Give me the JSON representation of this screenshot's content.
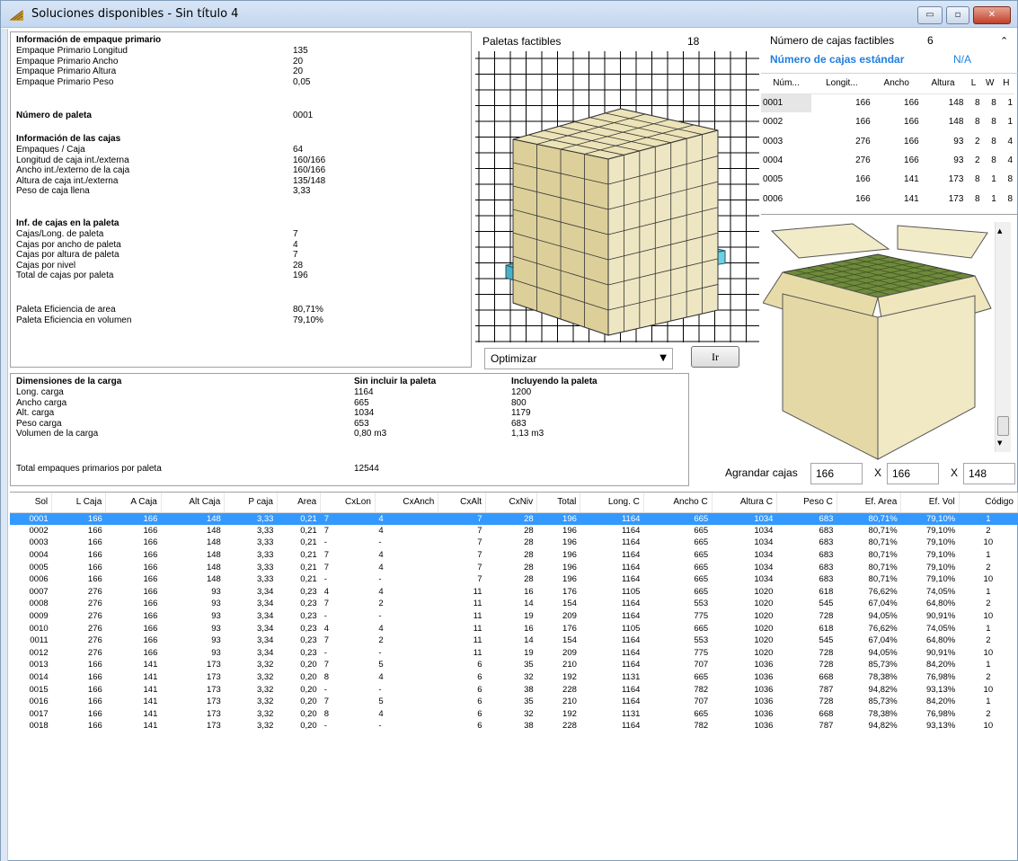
{
  "window": {
    "title": "Soluciones disponibles - Sin título 4",
    "minimize": "▭",
    "maximize": "▫",
    "close": "✕"
  },
  "primary": {
    "heading": "Información de empaque primario",
    "rows": [
      {
        "label": "Empaque Primario Longitud",
        "value": "135"
      },
      {
        "label": "Empaque Primario Ancho",
        "value": "20"
      },
      {
        "label": "Empaque Primario Altura",
        "value": "20"
      },
      {
        "label": "Empaque Primario Peso",
        "value": "0,05"
      }
    ],
    "pallet_label": "Número de paleta",
    "pallet_value": "0001",
    "cases_heading": "Información de las cajas",
    "cases_rows": [
      {
        "label": "Empaques / Caja",
        "value": "64"
      },
      {
        "label": "Longitud de caja int./externa",
        "value": "160/166"
      },
      {
        "label": "Ancho int./externo de la caja",
        "value": "160/166"
      },
      {
        "label": "Altura de caja int./externa",
        "value": "135/148"
      },
      {
        "label": "Peso de caja llena",
        "value": "3,33"
      }
    ],
    "pallet_heading": "Inf. de cajas en la paleta",
    "pallet_rows": [
      {
        "label": "Cajas/Long. de paleta",
        "value": "7"
      },
      {
        "label": "Cajas por ancho de paleta",
        "value": "4"
      },
      {
        "label": "Cajas por altura de paleta",
        "value": "7"
      },
      {
        "label": "Cajas por nivel",
        "value": "28"
      },
      {
        "label": "Total de cajas por paleta",
        "value": "196"
      }
    ],
    "eff_rows": [
      {
        "label": "Paleta Eficiencia de area",
        "value": "80,71%"
      },
      {
        "label": "Paleta Eficiencia en volumen",
        "value": "79,10%"
      }
    ]
  },
  "load": {
    "heading": "Dimensiones de la carga",
    "col1": "Sin incluir la paleta",
    "col2": "Incluyendo la paleta",
    "rows": [
      {
        "label": "Long. carga",
        "a": "1164",
        "b": "1200"
      },
      {
        "label": "Ancho carga",
        "a": "665",
        "b": "800"
      },
      {
        "label": "Alt. carga",
        "a": "1034",
        "b": "1179"
      },
      {
        "label": "Peso carga",
        "a": "653",
        "b": "683"
      },
      {
        "label": "Volumen de la carga",
        "a": "0,80 m3",
        "b": "1,13 m3"
      }
    ],
    "total_label": "Total empaques primarios por paleta",
    "total_value": "12544"
  },
  "pallet_view": {
    "label": "Paletas factibles",
    "count": "18",
    "select_value": "Optimizar",
    "go_button": "Ir"
  },
  "cases": {
    "label": "Número de cajas factibles",
    "count": "6",
    "std_label": "Número de cajas estándar",
    "std_value": "N/A",
    "headers": [
      "Núm...",
      "Longit...",
      "Ancho",
      "Altura",
      "L",
      "W",
      "H"
    ],
    "rows": [
      [
        "0001",
        "166",
        "166",
        "148",
        "8",
        "8",
        "1"
      ],
      [
        "0002",
        "166",
        "166",
        "148",
        "8",
        "8",
        "1"
      ],
      [
        "0003",
        "276",
        "166",
        "93",
        "2",
        "8",
        "4"
      ],
      [
        "0004",
        "276",
        "166",
        "93",
        "2",
        "8",
        "4"
      ],
      [
        "0005",
        "166",
        "141",
        "173",
        "8",
        "1",
        "8"
      ],
      [
        "0006",
        "166",
        "141",
        "173",
        "8",
        "1",
        "8"
      ]
    ]
  },
  "enlarge": {
    "label": "Agrandar cajas",
    "x1": "166",
    "sep1": "X",
    "x2": "166",
    "sep2": "X",
    "x3": "148"
  },
  "solutions": {
    "headers": [
      "Sol",
      "L Caja",
      "A Caja",
      "Alt Caja",
      "P caja",
      "Area",
      "CxLon",
      "CxAnch",
      "CxAlt",
      "CxNiv",
      "Total",
      "Long. C",
      "Ancho C",
      "Altura C",
      "Peso C",
      "Ef. Area",
      "Ef. Vol",
      "Código"
    ],
    "rows": [
      [
        "0001",
        "166",
        "166",
        "148",
        "3,33",
        "0,21",
        "7",
        "4",
        "7",
        "28",
        "196",
        "1164",
        "665",
        "1034",
        "683",
        "80,71%",
        "79,10%",
        "1"
      ],
      [
        "0002",
        "166",
        "166",
        "148",
        "3,33",
        "0,21",
        "7",
        "4",
        "7",
        "28",
        "196",
        "1164",
        "665",
        "1034",
        "683",
        "80,71%",
        "79,10%",
        "2"
      ],
      [
        "0003",
        "166",
        "166",
        "148",
        "3,33",
        "0,21",
        "-",
        "-",
        "7",
        "28",
        "196",
        "1164",
        "665",
        "1034",
        "683",
        "80,71%",
        "79,10%",
        "10"
      ],
      [
        "0004",
        "166",
        "166",
        "148",
        "3,33",
        "0,21",
        "7",
        "4",
        "7",
        "28",
        "196",
        "1164",
        "665",
        "1034",
        "683",
        "80,71%",
        "79,10%",
        "1"
      ],
      [
        "0005",
        "166",
        "166",
        "148",
        "3,33",
        "0,21",
        "7",
        "4",
        "7",
        "28",
        "196",
        "1164",
        "665",
        "1034",
        "683",
        "80,71%",
        "79,10%",
        "2"
      ],
      [
        "0006",
        "166",
        "166",
        "148",
        "3,33",
        "0,21",
        "-",
        "-",
        "7",
        "28",
        "196",
        "1164",
        "665",
        "1034",
        "683",
        "80,71%",
        "79,10%",
        "10"
      ],
      [
        "0007",
        "276",
        "166",
        "93",
        "3,34",
        "0,23",
        "4",
        "4",
        "11",
        "16",
        "176",
        "1105",
        "665",
        "1020",
        "618",
        "76,62%",
        "74,05%",
        "1"
      ],
      [
        "0008",
        "276",
        "166",
        "93",
        "3,34",
        "0,23",
        "7",
        "2",
        "11",
        "14",
        "154",
        "1164",
        "553",
        "1020",
        "545",
        "67,04%",
        "64,80%",
        "2"
      ],
      [
        "0009",
        "276",
        "166",
        "93",
        "3,34",
        "0,23",
        "-",
        "-",
        "11",
        "19",
        "209",
        "1164",
        "775",
        "1020",
        "728",
        "94,05%",
        "90,91%",
        "10"
      ],
      [
        "0010",
        "276",
        "166",
        "93",
        "3,34",
        "0,23",
        "4",
        "4",
        "11",
        "16",
        "176",
        "1105",
        "665",
        "1020",
        "618",
        "76,62%",
        "74,05%",
        "1"
      ],
      [
        "0011",
        "276",
        "166",
        "93",
        "3,34",
        "0,23",
        "7",
        "2",
        "11",
        "14",
        "154",
        "1164",
        "553",
        "1020",
        "545",
        "67,04%",
        "64,80%",
        "2"
      ],
      [
        "0012",
        "276",
        "166",
        "93",
        "3,34",
        "0,23",
        "-",
        "-",
        "11",
        "19",
        "209",
        "1164",
        "775",
        "1020",
        "728",
        "94,05%",
        "90,91%",
        "10"
      ],
      [
        "0013",
        "166",
        "141",
        "173",
        "3,32",
        "0,20",
        "7",
        "5",
        "6",
        "35",
        "210",
        "1164",
        "707",
        "1036",
        "728",
        "85,73%",
        "84,20%",
        "1"
      ],
      [
        "0014",
        "166",
        "141",
        "173",
        "3,32",
        "0,20",
        "8",
        "4",
        "6",
        "32",
        "192",
        "1131",
        "665",
        "1036",
        "668",
        "78,38%",
        "76,98%",
        "2"
      ],
      [
        "0015",
        "166",
        "141",
        "173",
        "3,32",
        "0,20",
        "-",
        "-",
        "6",
        "38",
        "228",
        "1164",
        "782",
        "1036",
        "787",
        "94,82%",
        "93,13%",
        "10"
      ],
      [
        "0016",
        "166",
        "141",
        "173",
        "3,32",
        "0,20",
        "7",
        "5",
        "6",
        "35",
        "210",
        "1164",
        "707",
        "1036",
        "728",
        "85,73%",
        "84,20%",
        "1"
      ],
      [
        "0017",
        "166",
        "141",
        "173",
        "3,32",
        "0,20",
        "8",
        "4",
        "6",
        "32",
        "192",
        "1131",
        "665",
        "1036",
        "668",
        "78,38%",
        "76,98%",
        "2"
      ],
      [
        "0018",
        "166",
        "141",
        "173",
        "3,32",
        "0,20",
        "-",
        "-",
        "6",
        "38",
        "228",
        "1164",
        "782",
        "1036",
        "787",
        "94,82%",
        "93,13%",
        "10"
      ]
    ]
  },
  "colors": {
    "selection": "#3399ff",
    "std_label": "#1f7fe0",
    "box_fill": "#e9dfae",
    "pallet": "#5bc6dc"
  }
}
